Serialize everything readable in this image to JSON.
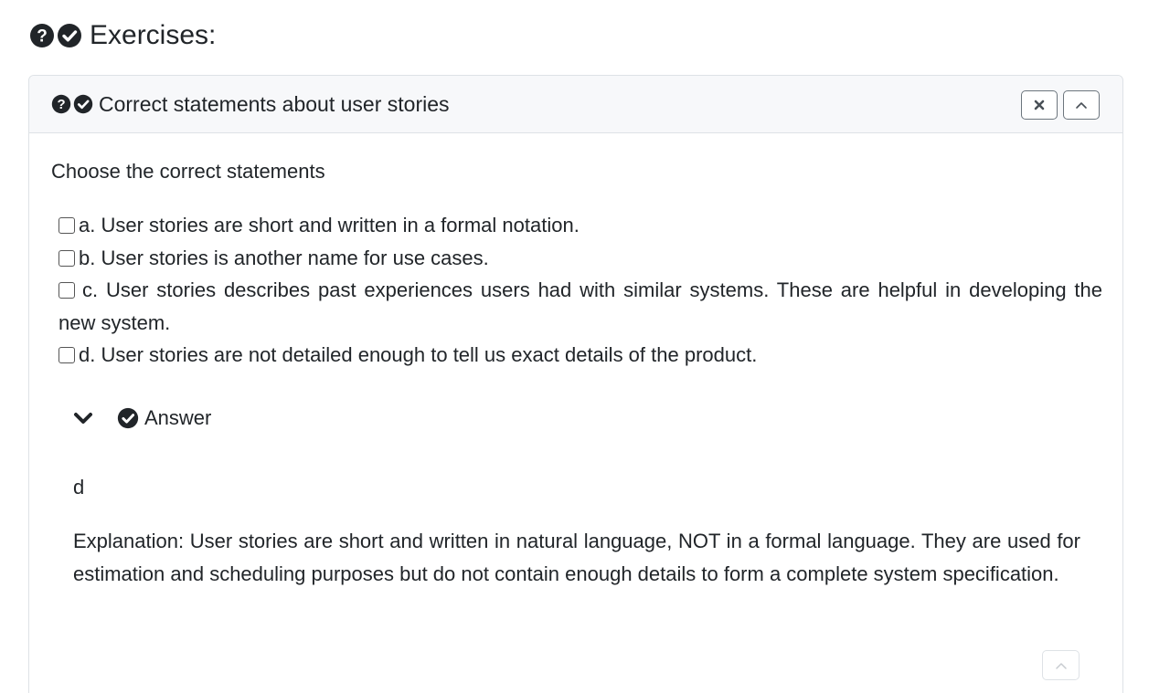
{
  "page": {
    "heading": "Exercises:",
    "icons": [
      "question-circle-icon",
      "check-circle-icon"
    ]
  },
  "card": {
    "title": "Correct statements about user stories",
    "icons": [
      "question-circle-icon",
      "check-circle-icon"
    ],
    "close_icon": "close-icon",
    "collapse_icon": "chevron-up-icon",
    "prompt": "Choose the correct statements",
    "options": [
      {
        "label": "a. User stories are short and written in a formal notation.",
        "checked": false
      },
      {
        "label": "b. User stories is another name for use cases.",
        "checked": false
      },
      {
        "label": "c. User stories describes past experiences users had with similar systems. These are helpful in developing the new system.",
        "checked": false
      },
      {
        "label": "d. User stories are not detailed enough to tell us exact details of the product.",
        "checked": false
      }
    ],
    "answer": {
      "toggle_label": "Answer",
      "toggle_icon": "chevron-down-icon",
      "value": "d",
      "explanation": "Explanation: User stories are short and written in natural language, NOT in a formal language. They are used for estimation and scheduling purposes but do not contain enough details to form a complete system specification."
    },
    "back_to_top_icon": "chevron-up-icon"
  }
}
